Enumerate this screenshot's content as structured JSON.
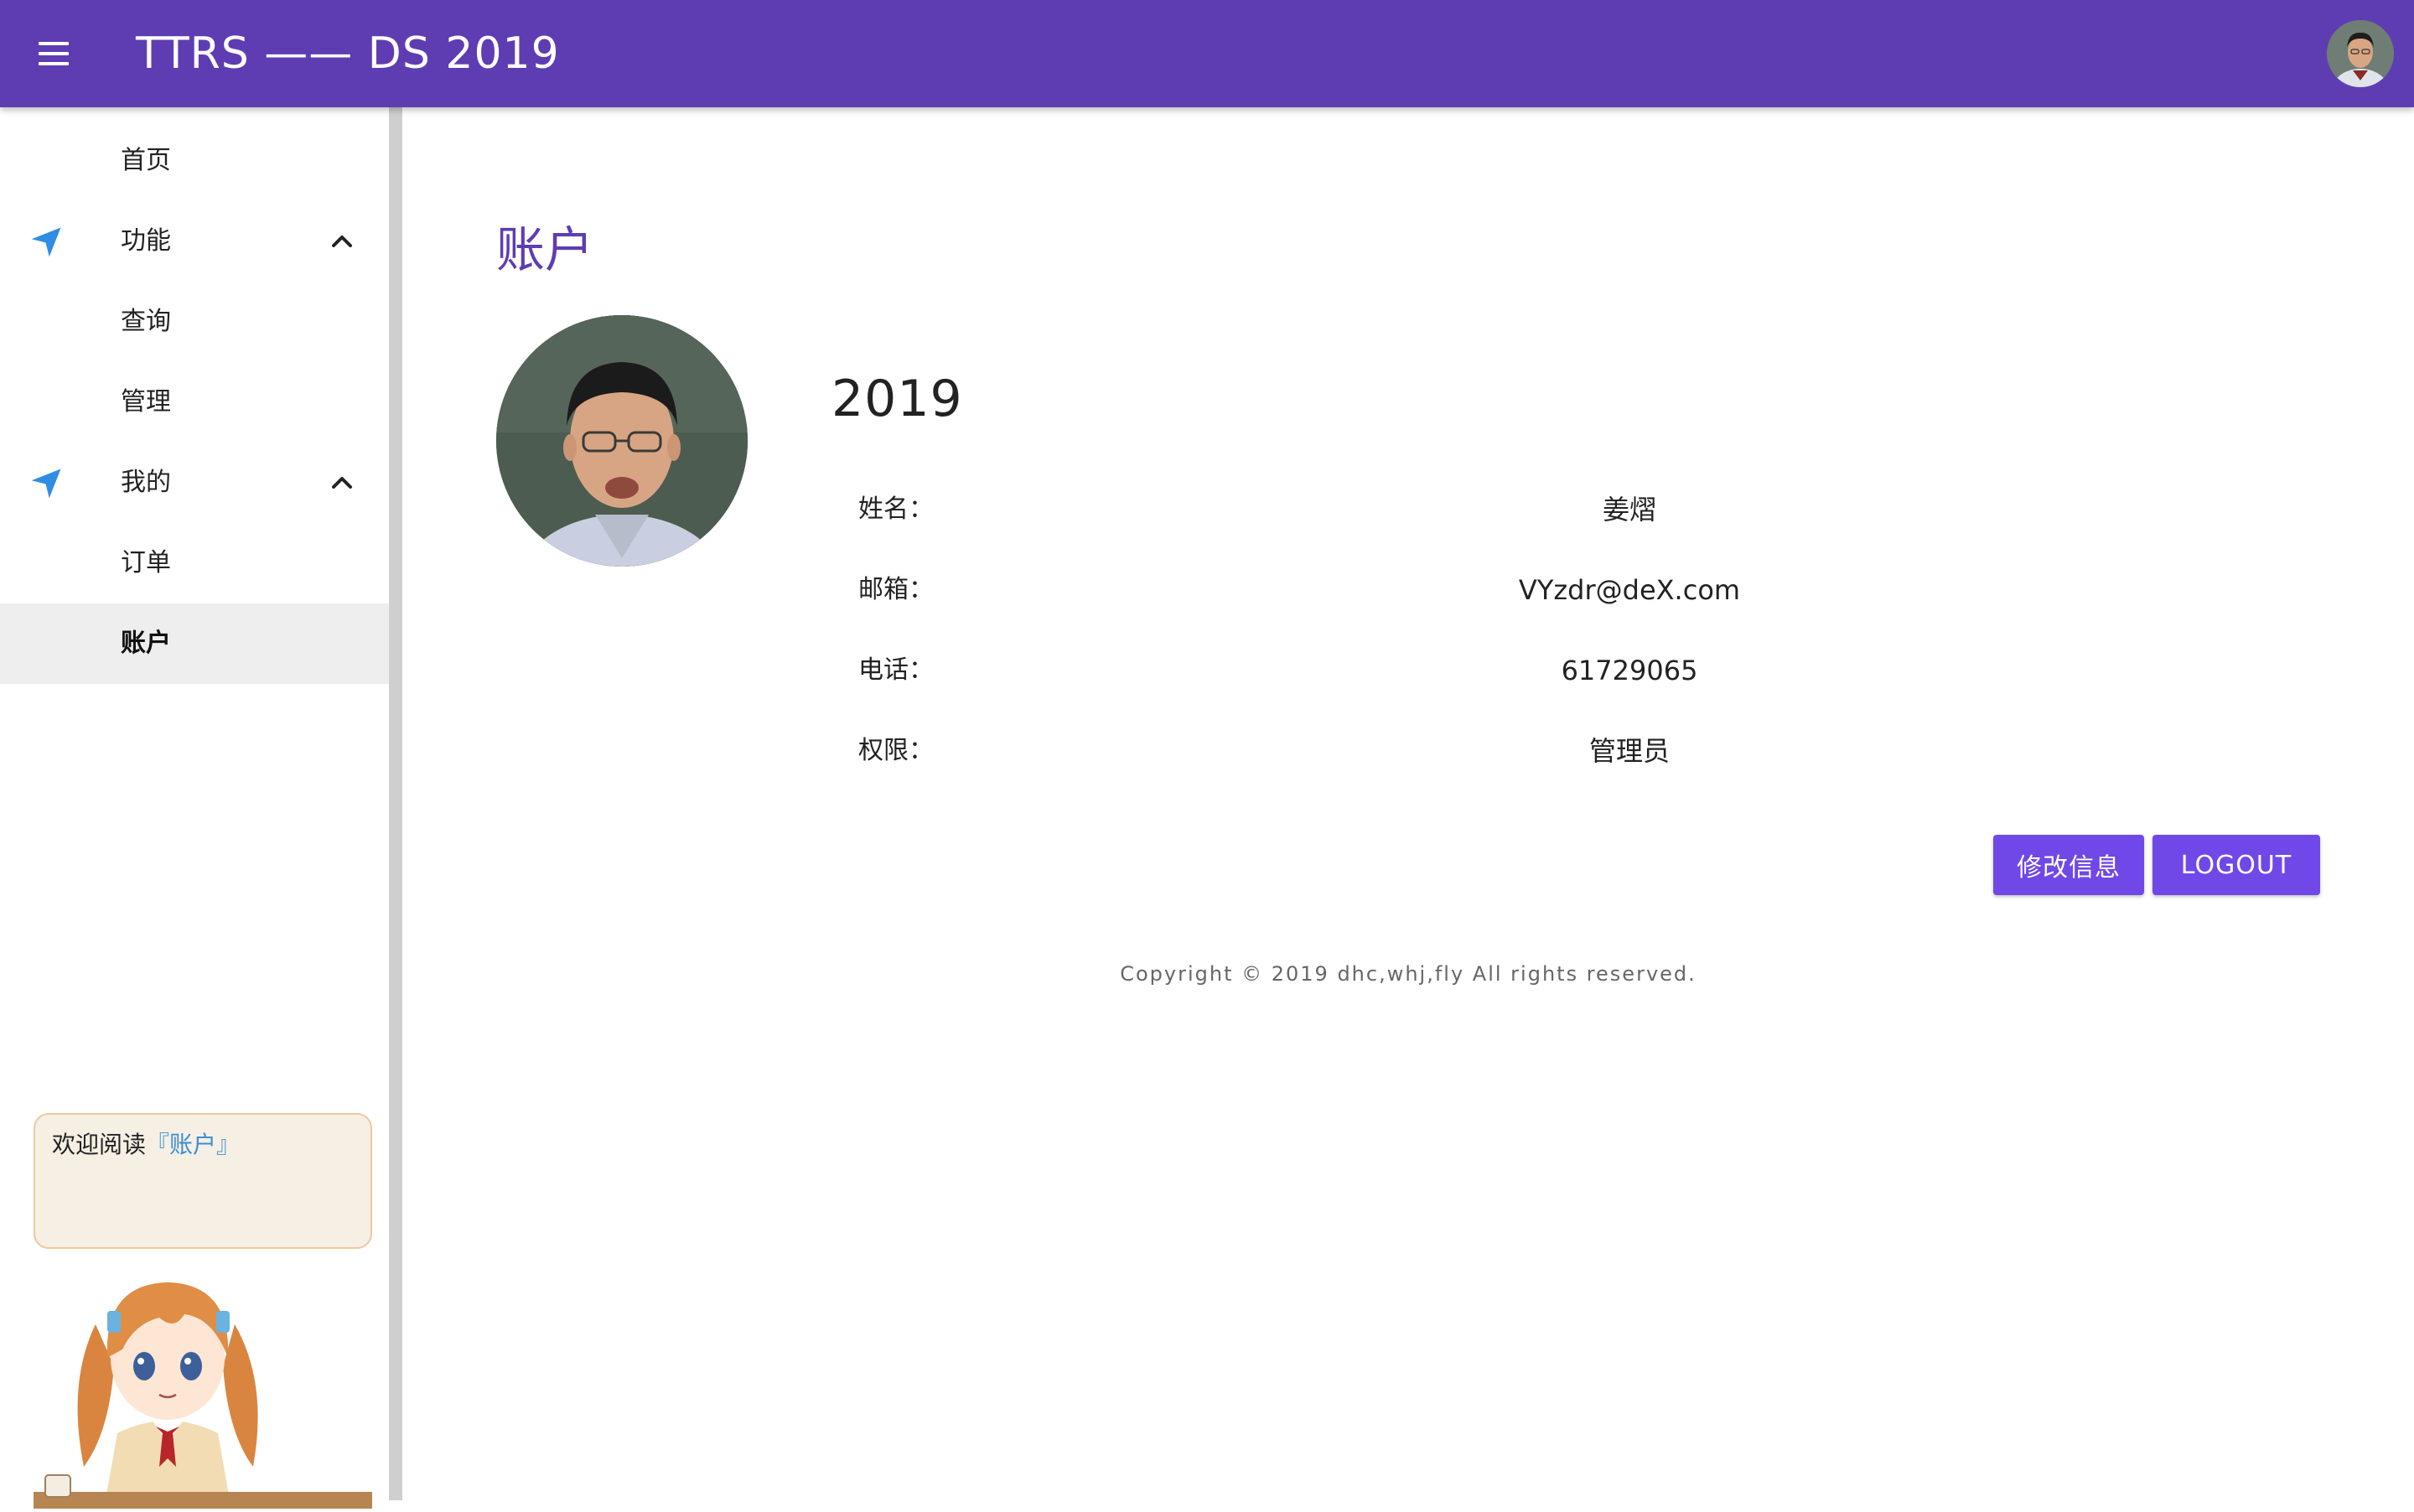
{
  "appbar": {
    "title": "TTRS —— DS 2019",
    "menu_icon": "hamburger-menu-icon",
    "avatar": "user-avatar"
  },
  "sidebar": {
    "items": [
      {
        "label": "首页"
      },
      {
        "label": "功能",
        "icon": "navigation-arrow-icon",
        "expanded": true
      },
      {
        "label": "查询"
      },
      {
        "label": "管理"
      },
      {
        "label": "我的",
        "icon": "navigation-arrow-icon",
        "expanded": true
      },
      {
        "label": "订单"
      },
      {
        "label": "账户",
        "selected": true
      }
    ]
  },
  "mascot": {
    "greeting_prefix": "欢迎阅读",
    "greeting_link": "『账户』"
  },
  "main": {
    "title": "账户",
    "user_name": "2019",
    "fields": [
      {
        "label": "姓名：",
        "value": "姜熠"
      },
      {
        "label": "邮箱：",
        "value": "VYzdr@deX.com"
      },
      {
        "label": "电话：",
        "value": "61729065"
      },
      {
        "label": "权限：",
        "value": "管理员"
      }
    ],
    "edit_button": "修改信息",
    "logout_button": "LOGOUT",
    "copyright": "Copyright © 2019 dhc,whj,fly All rights reserved."
  },
  "colors": {
    "primary": "#5e3db3",
    "button": "#7048e8",
    "nav_icon": "#2f8de4",
    "selected_bg": "#eeeeee",
    "bubble_bg": "#f6efe4"
  }
}
